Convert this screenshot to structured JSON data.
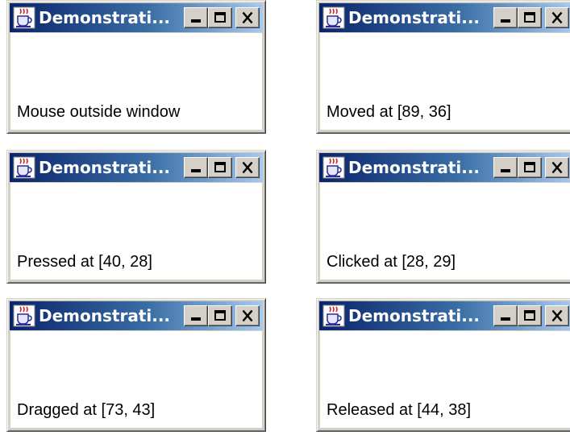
{
  "windows": [
    {
      "title": "Demonstrati...",
      "status": "Mouse outside window"
    },
    {
      "title": "Demonstrati...",
      "status": "Moved at [89, 36]"
    },
    {
      "title": "Demonstrati...",
      "status": "Pressed at [40, 28]"
    },
    {
      "title": "Demonstrati...",
      "status": "Clicked at [28, 29]"
    },
    {
      "title": "Demonstrati...",
      "status": "Dragged at [73, 43]"
    },
    {
      "title": "Demonstrati...",
      "status": "Released at [44, 38]"
    }
  ],
  "icons": {
    "app": "java-cup-icon",
    "minimize": "minimize-icon",
    "maximize": "maximize-icon",
    "close": "close-icon"
  },
  "colors": {
    "titlebar_start": "#0a246a",
    "titlebar_end": "#a6caf0",
    "window_face": "#d4d0c8",
    "content_bg": "#ffffff"
  }
}
